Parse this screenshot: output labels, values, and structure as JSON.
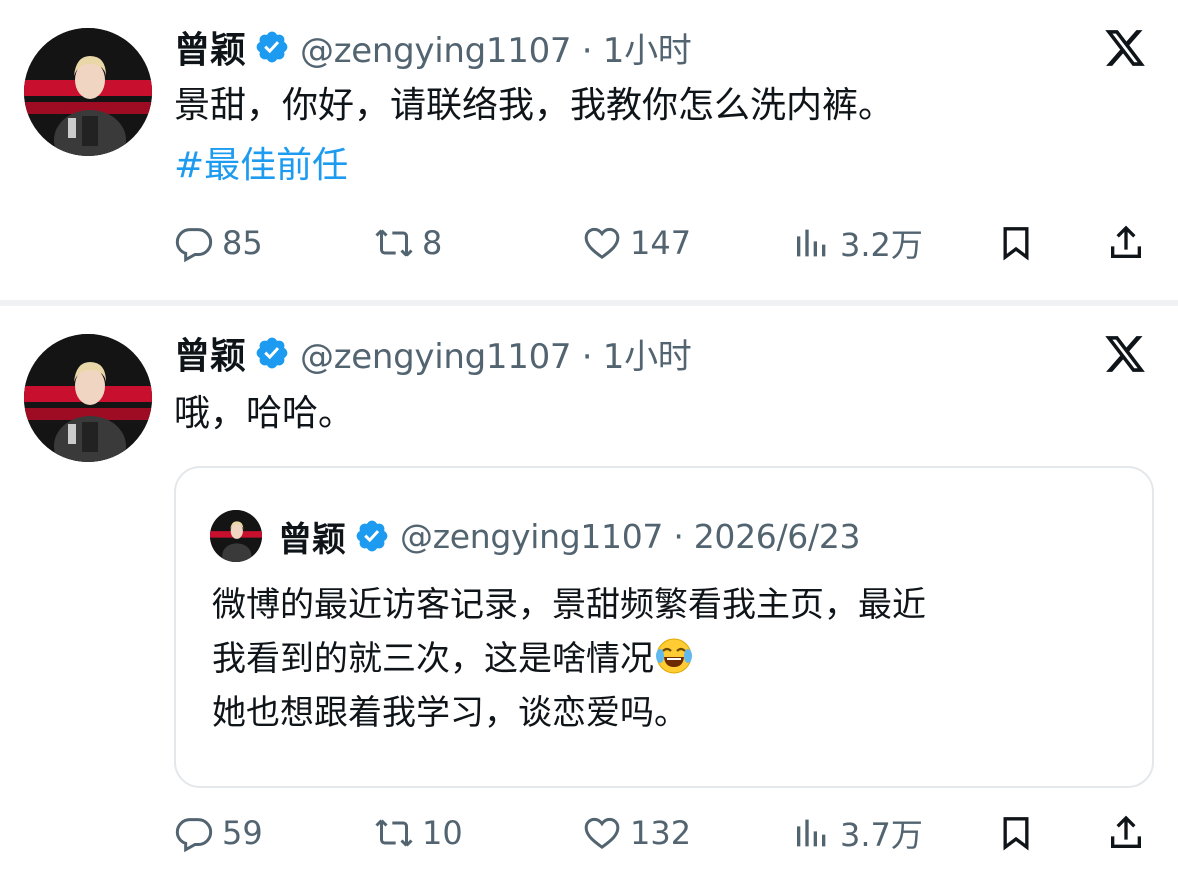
{
  "tweets": [
    {
      "author_name": "曾颖",
      "handle_time": "@zengying1107 · 1小时",
      "text": "景甜，你好，请联络我，我教你怎么洗内裤。",
      "hashtag": "#最佳前任",
      "replies": "85",
      "reposts": "8",
      "likes": "147",
      "views": "3.2万"
    },
    {
      "author_name": "曾颖",
      "handle_time": "@zengying1107 · 1小时",
      "text": "哦，哈哈。",
      "replies": "59",
      "reposts": "10",
      "likes": "132",
      "views": "3.7万",
      "quote": {
        "author_name": "曾颖",
        "handle_date": "@zengying1107 · 2026/6/23",
        "line1": "微博的最近访客记录，景甜频繁看我主页，最近",
        "line2": "我看到的就三次，这是啥情况",
        "line3": "她也想跟着我学习，谈恋爱吗。",
        "emoji": "face-with-tears-of-joy"
      }
    }
  ],
  "colors": {
    "text": "#0f1419",
    "secondary": "#536471",
    "link": "#1d9bf0",
    "verified": "#1d9bf0",
    "border": "#e4e8eb"
  }
}
